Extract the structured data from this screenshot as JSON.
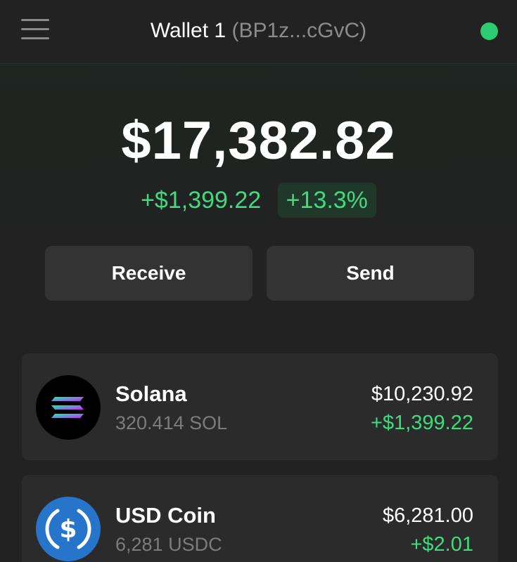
{
  "header": {
    "menu_icon": "hamburger-menu-icon",
    "wallet_name": "Wallet 1",
    "wallet_address": "(BP1z...cGvC)",
    "status_color": "#2ecc71"
  },
  "portfolio": {
    "balance": "$17,382.82",
    "change_amount": "+$1,399.22",
    "change_percent": "+13.3%"
  },
  "actions": {
    "receive_label": "Receive",
    "send_label": "Send"
  },
  "tokens": [
    {
      "name": "Solana",
      "quantity": "320.414 SOL",
      "value": "$10,230.92",
      "change": "+$1,399.22",
      "icon": "solana-logo-icon"
    },
    {
      "name": "USD Coin",
      "quantity": "6,281 USDC",
      "value": "$6,281.00",
      "change": "+$2.01",
      "icon": "usdc-logo-icon"
    }
  ],
  "colors": {
    "positive": "#3fdb7c",
    "background": "#222222",
    "card": "#2b2b2b",
    "button": "#333333"
  }
}
